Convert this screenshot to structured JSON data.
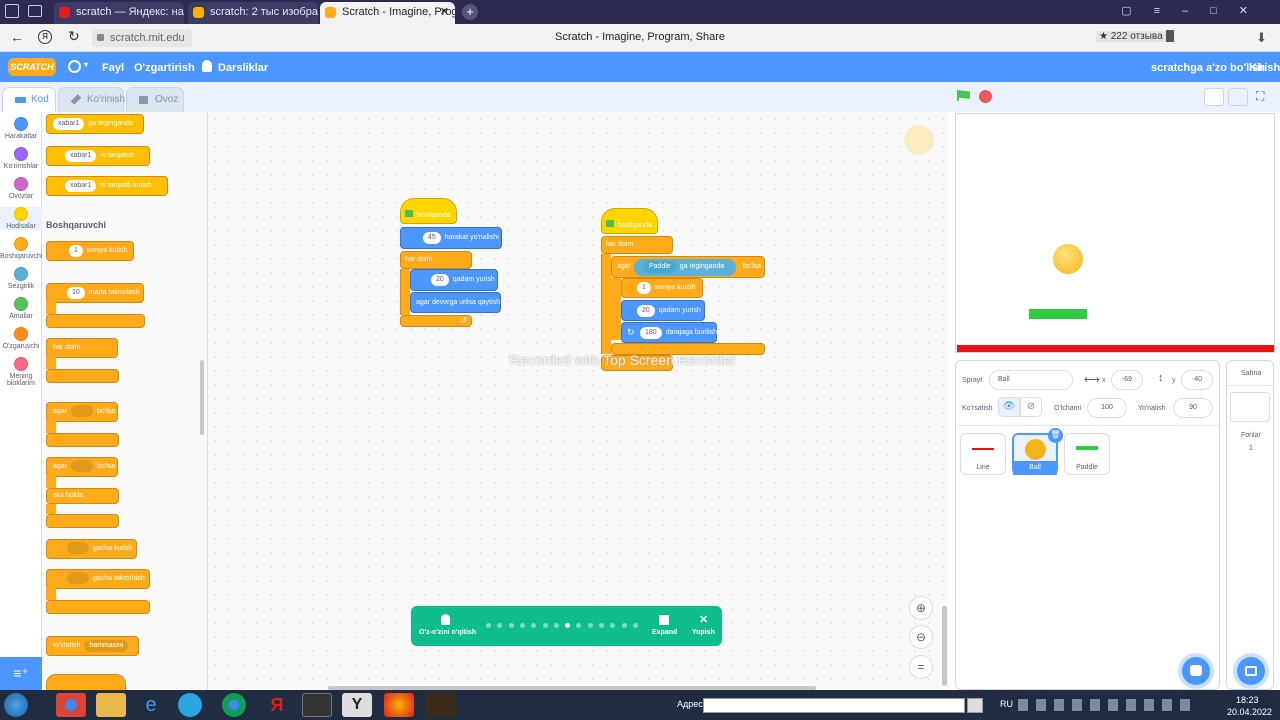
{
  "browser": {
    "tabs": [
      {
        "label": "scratch — Яндекс: нашёлось"
      },
      {
        "label": "scratch: 2 тыс изображений"
      },
      {
        "label": "Scratch - Imagine, Progr"
      }
    ],
    "url": "scratch.mit.edu",
    "page_title": "Scratch - Imagine, Program, Share",
    "reviews": "★ 222 отзыва"
  },
  "menu": {
    "logo": "SCRATCH",
    "file": "Fayl",
    "edit": "O'zgartirish",
    "tutorials": "Darsliklar",
    "join": "scratchga a'zo bo'lish",
    "signin": "Kirish"
  },
  "editor_tabs": {
    "code": "Kod",
    "costumes": "Ko'rinish",
    "sounds": "Ovoz"
  },
  "categories": [
    {
      "label": "Harakatlar",
      "color": "#4c97ff"
    },
    {
      "label": "Ko'rinishlar",
      "color": "#9966ff"
    },
    {
      "label": "Ovozlar",
      "color": "#cf63cf"
    },
    {
      "label": "Hodisalar",
      "color": "#ffd500"
    },
    {
      "label": "Boshqaruvchi",
      "color": "#ffab19"
    },
    {
      "label": "Sezgirlik",
      "color": "#5cb1d6"
    },
    {
      "label": "Amallar",
      "color": "#59c059"
    },
    {
      "label": "O'zgaruvchi",
      "color": "#ff8c1a"
    },
    {
      "label": "Mening bloklarim",
      "color": "#ff6680"
    }
  ],
  "palette": {
    "msg_block1": "xabar1",
    "msg_block1_text": "ga teginganda",
    "msg_block2": "xabar1",
    "msg_block2_text": "ni tarqatish",
    "msg_block3": "xabar1",
    "msg_block3_text": "ni tarqatib kutish",
    "section_control": "Boshqaruvchi",
    "wait_value": "1",
    "wait_text": "soniya kutish",
    "repeat_value": "10",
    "repeat_text": "marta takrorlash",
    "forever": "har doim",
    "if1_a": "agar",
    "if1_b": "bo'lsa",
    "if2_a": "agar",
    "if2_b": "bo'lsa",
    "else": "aks holda",
    "wait_until": "gacha kutish",
    "repeat_until": "gacha takrorlash",
    "stop": "to'xtatish",
    "stop_option": "hammasini"
  },
  "script1": {
    "hat": "bosilganda",
    "direction_value": "45",
    "direction_text": "harakat yo'nalishi",
    "forever": "har doim",
    "move_value": "20",
    "move_text": "qadam yurish",
    "bounce": "agar devorga urilsa qaytish"
  },
  "script2": {
    "hat": "bosilganda",
    "forever": "har doim",
    "if": "agar",
    "touching_target": "Paddle",
    "touching_text": "ga teginganda",
    "then": "bo'lsa",
    "wait_value": "1",
    "wait_text": "soniya kutish",
    "move_value": "20",
    "move_text": "qadam yurish",
    "turn_value": "180",
    "turn_text": "darajaga burilish"
  },
  "watermark": "Recorded with Top Screen Recorder",
  "tutorial_bar": {
    "label": "O'z-o'zini o'qitish",
    "expand": "Expand",
    "close": "Yopish",
    "steps": 14,
    "active_step": 8
  },
  "sprite_info": {
    "sprite_label": "Sprayt",
    "sprite_name": "Ball",
    "x_label": "x",
    "x_value": "-69",
    "y_label": "y",
    "y_value": "-40",
    "show_label": "Ko'rsatish",
    "size_label": "O'lchami",
    "size_value": "100",
    "direction_label": "Yo'nalish",
    "direction_value": "90"
  },
  "sprites": [
    {
      "name": "Line"
    },
    {
      "name": "Ball"
    },
    {
      "name": "Paddle"
    }
  ],
  "stage_panel": {
    "title": "Sahna",
    "backdrops_label": "Fonlar",
    "backdrops_count": "1"
  },
  "taskbar": {
    "address_label": "Адрес",
    "lang": "RU",
    "time": "18:23",
    "date": "20.04.2022"
  },
  "colors": {
    "accent": "#4c97ff",
    "events": "#ffbf00",
    "control": "#ffab19",
    "motion": "#4c97ff",
    "tutorial": "#0fbd8c",
    "paddle": "#2ecc40",
    "line": "#e81414"
  }
}
